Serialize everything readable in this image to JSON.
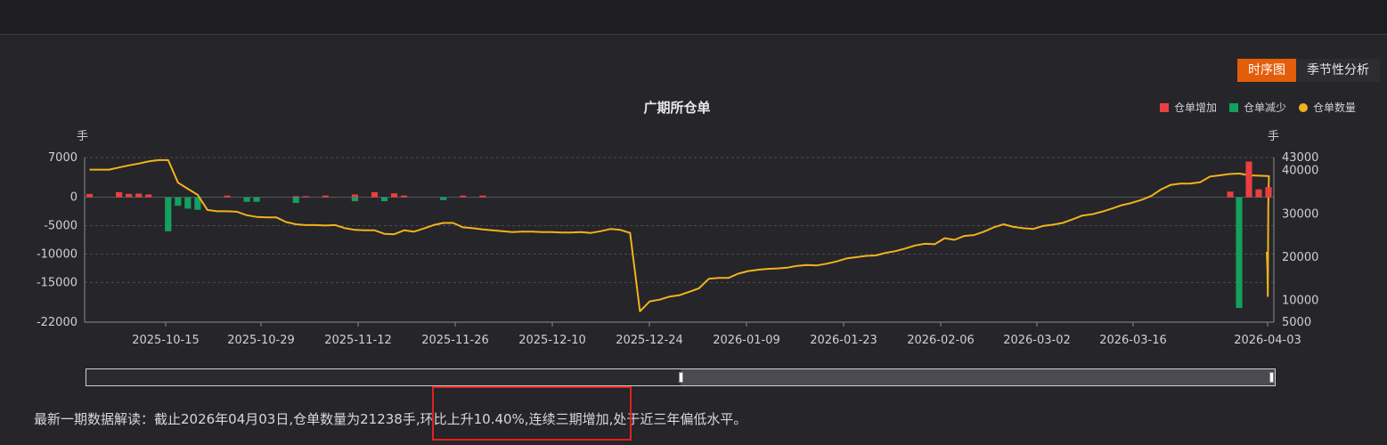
{
  "tabs": [
    {
      "label": "时序图",
      "active": true
    },
    {
      "label": "季节性分析",
      "active": false
    }
  ],
  "chart_title": "广期所仓单",
  "legend": [
    {
      "label": "仓单增加",
      "color": "#e8403f",
      "shape": "square"
    },
    {
      "label": "仓单减少",
      "color": "#14a05e",
      "shape": "square"
    },
    {
      "label": "仓单数量",
      "color": "#f2b21b",
      "shape": "circle"
    }
  ],
  "units": {
    "left": "手",
    "right": "手"
  },
  "chart_data": {
    "type": "bar+line",
    "title": "广期所仓单",
    "y_left": {
      "ticks": [
        7000,
        0,
        -5000,
        -10000,
        -15000,
        -22000
      ],
      "range": [
        -22000,
        7000
      ],
      "unit": "手"
    },
    "y_right": {
      "ticks": [
        43000,
        40000,
        30000,
        20000,
        10000,
        5000
      ],
      "range": [
        5000,
        43000
      ],
      "unit": "手"
    },
    "x_ticks": [
      "2025-10-15",
      "2025-10-29",
      "2025-11-12",
      "2025-11-26",
      "2025-12-10",
      "2025-12-24",
      "2026-01-09",
      "2026-01-23",
      "2026-02-06",
      "2026-03-02",
      "2026-03-16",
      "2026-04-03"
    ],
    "grid": true,
    "series": [
      {
        "name": "仓单增加",
        "kind": "bar",
        "color": "#e8403f",
        "values": [
          600,
          0,
          0,
          900,
          600,
          650,
          500,
          0,
          0,
          0,
          0,
          0,
          0,
          0,
          300,
          0,
          0,
          0,
          0,
          0,
          0,
          200,
          200,
          0,
          300,
          0,
          0,
          500,
          0,
          900,
          0,
          700,
          300,
          0,
          0,
          0,
          0,
          0,
          300,
          0,
          300,
          0,
          0,
          0,
          0,
          0,
          0,
          0,
          0,
          0,
          0,
          0,
          0,
          0,
          0,
          0,
          0,
          0,
          0,
          0,
          0,
          0,
          0,
          0,
          0,
          0,
          0,
          0,
          0,
          0,
          0,
          0,
          0,
          0,
          0,
          0,
          0,
          0,
          0,
          0,
          0,
          0,
          0,
          0,
          0,
          0,
          0,
          0,
          0,
          0,
          0,
          0,
          0,
          0,
          0,
          0,
          0,
          0,
          0,
          0,
          0,
          0,
          0,
          0,
          0,
          0,
          0,
          0,
          0,
          0,
          0,
          0,
          0,
          0,
          0,
          0,
          0,
          0,
          0,
          0,
          0
        ]
      },
      {
        "name": "仓单减少",
        "kind": "bar",
        "color": "#14a05e",
        "values": [
          0,
          0,
          0,
          0,
          0,
          0,
          0,
          0,
          -6000,
          -1500,
          -2000,
          -2200,
          0,
          0,
          0,
          0,
          -800,
          -800,
          0,
          0,
          0,
          -1000,
          0,
          0,
          0,
          0,
          0,
          -700,
          0,
          0,
          -700,
          0,
          0,
          0,
          0,
          0,
          -500,
          0,
          0,
          0,
          0,
          0,
          0,
          0,
          0,
          0,
          0,
          0,
          0,
          0,
          0,
          0,
          0,
          0,
          0,
          0,
          0,
          0,
          0,
          0,
          0,
          0,
          0,
          0,
          0,
          0,
          0,
          0,
          0,
          0,
          0,
          0,
          0,
          0,
          0,
          0,
          0,
          0,
          0,
          0,
          0,
          0,
          0,
          0,
          0,
          0,
          0,
          0,
          0,
          0,
          0,
          0,
          0,
          0,
          0,
          0,
          0,
          0,
          0,
          0,
          0,
          0,
          0,
          0,
          0,
          0,
          0,
          0,
          0,
          0,
          0,
          0,
          0,
          0,
          0,
          0,
          0,
          0,
          0,
          0,
          0
        ]
      },
      {
        "name": "仓单数量",
        "kind": "line",
        "color": "#f2b21b",
        "axis": "right",
        "values": [
          40200,
          40200,
          40200,
          40700,
          41200,
          41600,
          42100,
          42400,
          42400,
          37200,
          35800,
          34400,
          30900,
          30600,
          30600,
          30500,
          29700,
          29300,
          29200,
          29200,
          28100,
          27600,
          27400,
          27400,
          27300,
          27400,
          26700,
          26300,
          26200,
          26200,
          25400,
          25300,
          26200,
          25900,
          26600,
          27400,
          27900,
          27900,
          26900,
          26700,
          26400,
          26200,
          26000,
          25800,
          25900,
          25900,
          25800,
          25800,
          25700,
          25700,
          25800,
          25600,
          26000,
          26500,
          26300,
          25600,
          7500,
          9800,
          10200,
          10900,
          11200,
          12000,
          12800,
          15000,
          15200,
          15200,
          16200,
          16800,
          17100,
          17300,
          17400,
          17600,
          18000,
          18200,
          18100,
          18500,
          19000,
          19700,
          20000,
          20300,
          20400,
          21000,
          21400,
          22000,
          22700,
          23100,
          23000,
          24400,
          24000,
          24900,
          25100,
          25900,
          26900,
          27600,
          27000,
          26700,
          26500,
          27200,
          27500,
          27900,
          28700,
          29600,
          29900,
          30500,
          31200,
          32000,
          32500,
          33200,
          34100,
          35600,
          36700,
          37000,
          37000,
          37300,
          38600,
          38900,
          39200,
          39300,
          38900,
          38800,
          38700
        ]
      }
    ],
    "note": "bar and line values approximated from the image; latest bars show large decrease then increase near 2026-04-03"
  },
  "slider": {
    "left_handle": "▯",
    "right_handle": "▯"
  },
  "interpretation": "最新一期数据解读：截止2026年04月03日,仓单数量为21238手,环比上升10.40%,连续三期增加,处于近三年偏低水平。"
}
